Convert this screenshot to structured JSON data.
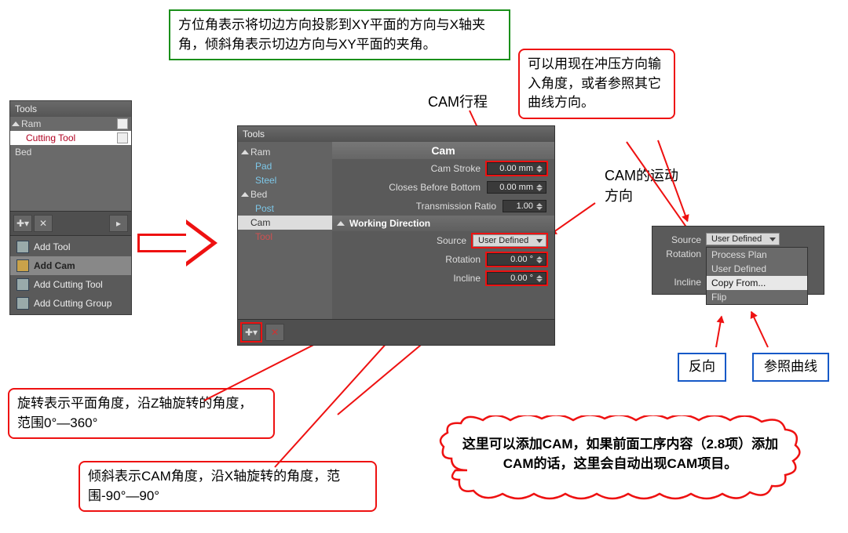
{
  "annotations": {
    "top_green": "方位角表示将切边方向投影到XY平面的方向与X轴夹角，倾斜角表示切边方向与XY平面的夹角。",
    "cam_stroke_label": "CAM行程",
    "cam_motion_label": "CAM的运动方向",
    "right_red_box": "可以用现在冲压方向输入角度，或者参照其它曲线方向。",
    "rotation_box": "旋转表示平面角度，沿Z轴旋转的角度，范围0°—360°",
    "incline_box": "倾斜表示CAM角度，沿X轴旋转的角度，范围-90°—90°",
    "blue_left": "反向",
    "blue_right": "参照曲线",
    "cloud": "这里可以添加CAM，如果前面工序内容（2.8项）添加CAM的话，这里会自动出现CAM项目。"
  },
  "left_panel": {
    "title": "Tools",
    "ram": "Ram",
    "cutting_tool": "Cutting Tool",
    "bed": "Bed",
    "menu": {
      "add_tool": "Add Tool",
      "add_cam": "Add Cam",
      "add_cutting_tool": "Add Cutting Tool",
      "add_cutting_group": "Add Cutting Group"
    }
  },
  "center_panel": {
    "title": "Tools",
    "tree": {
      "ram": "Ram",
      "pad": "Pad",
      "steel": "Steel",
      "bed": "Bed",
      "post": "Post",
      "cam": "Cam",
      "tool": "Tool"
    },
    "header": "Cam",
    "fields": {
      "cam_stroke_label": "Cam Stroke",
      "cam_stroke_value": "0.00 mm",
      "closes_label": "Closes Before Bottom",
      "closes_value": "0.00 mm",
      "trans_label": "Transmission Ratio",
      "trans_value": "1.00"
    },
    "working_dir": {
      "title": "Working Direction",
      "source_label": "Source",
      "source_value": "User Defined",
      "rotation_label": "Rotation",
      "rotation_value": "0.00 °",
      "incline_label": "Incline",
      "incline_value": "0.00 °"
    }
  },
  "src_panel": {
    "source_label": "Source",
    "selected": "User Defined",
    "rotation_label": "Rotation",
    "incline_label": "Incline",
    "options": {
      "process_plan": "Process Plan",
      "user_defined": "User Defined",
      "copy_from": "Copy From...",
      "flip": "Flip"
    }
  }
}
